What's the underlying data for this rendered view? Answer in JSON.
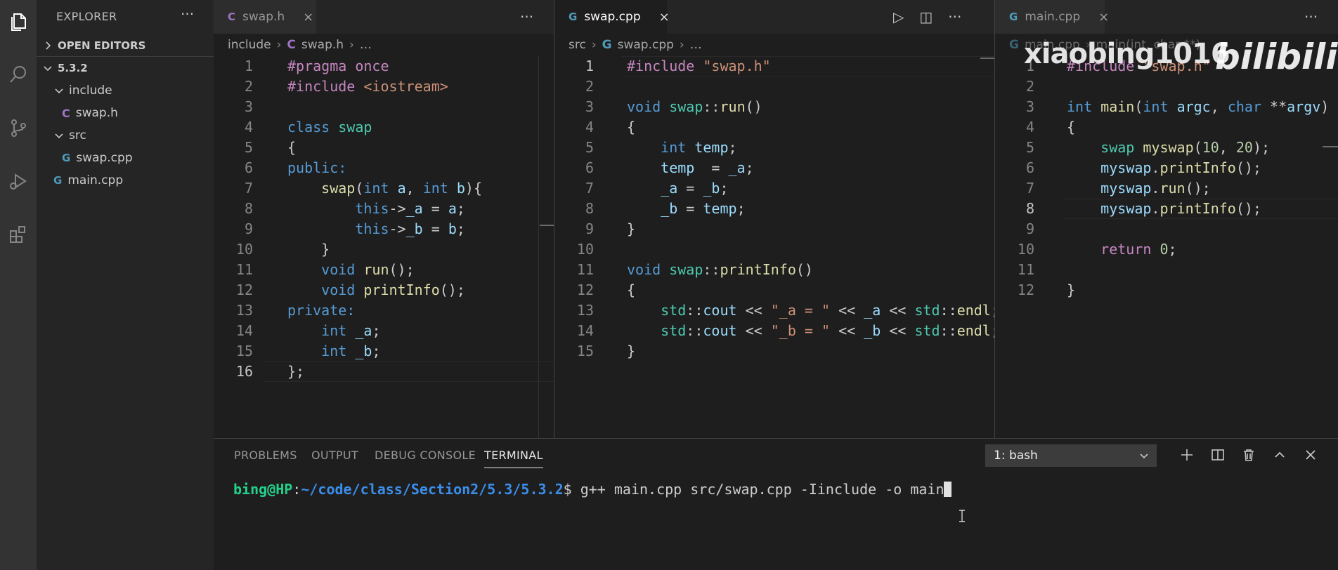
{
  "activity_bar": {
    "items": [
      "files-icon",
      "search-icon",
      "source-control-icon",
      "run-debug-icon",
      "extensions-icon"
    ]
  },
  "sidebar": {
    "title": "EXPLORER",
    "more": "···",
    "open_editors": "OPEN EDITORS",
    "root": "5.3.2",
    "tree": [
      {
        "type": "folder",
        "label": "include"
      },
      {
        "type": "file-c",
        "label": "swap.h",
        "icon": "C"
      },
      {
        "type": "folder",
        "label": "src"
      },
      {
        "type": "file-cpp",
        "label": "swap.cpp",
        "icon": "G"
      },
      {
        "type": "file-cpp",
        "label": "main.cpp",
        "icon": "G"
      }
    ]
  },
  "editor1": {
    "tab": {
      "label": "swap.h",
      "icon": "C",
      "close": "×"
    },
    "more": "···",
    "breadcrumb": [
      "include",
      "swap.h",
      "…"
    ],
    "line_numbers": [
      "1",
      "2",
      "3",
      "4",
      "5",
      "6",
      "7",
      "8",
      "9",
      "10",
      "11",
      "12",
      "13",
      "14",
      "15",
      "16"
    ]
  },
  "editor2": {
    "tab": {
      "label": "swap.cpp",
      "icon": "G",
      "close": "×"
    },
    "tools": {
      "run": "▷",
      "split": "◫",
      "more": "···"
    },
    "breadcrumb": [
      "src",
      "swap.cpp",
      "…"
    ],
    "line_numbers": [
      "1",
      "2",
      "3",
      "4",
      "5",
      "6",
      "7",
      "8",
      "9",
      "10",
      "11",
      "12",
      "13",
      "14",
      "15"
    ]
  },
  "editor3": {
    "tab": {
      "label": "main.cpp",
      "icon": "G",
      "close": "×"
    },
    "more": "···",
    "breadcrumb": [
      "main.cpp",
      "main(int, char **)"
    ],
    "line_numbers": [
      "1",
      "2",
      "3",
      "4",
      "5",
      "6",
      "7",
      "8",
      "9",
      "10",
      "11",
      "12"
    ]
  },
  "panel": {
    "tabs": [
      "PROBLEMS",
      "OUTPUT",
      "DEBUG CONSOLE",
      "TERMINAL"
    ],
    "active_tab": "TERMINAL",
    "terminal_select": "1: bash",
    "terminal": {
      "user": "bing@HP",
      "colon": ":",
      "path": "~/code/class/Section2/5.3/5.3.2",
      "prompt": "$ ",
      "command": "g++ main.cpp src/swap.cpp -Iinclude -o main"
    }
  },
  "watermark": {
    "text": "xiaobing1016",
    "logo": "bilibili"
  },
  "colors": {
    "activity_bar": "#333333",
    "sidebar": "#252526",
    "editor": "#1e1e1e",
    "keyword": "#569cd6",
    "string": "#ce9178",
    "function": "#dcdcaa",
    "type": "#4ec9b0",
    "variable": "#9cdcfe",
    "number": "#b5cea8",
    "preprocessor": "#c586c0",
    "terminal_user": "#23d18b",
    "terminal_path": "#3b8eea"
  }
}
